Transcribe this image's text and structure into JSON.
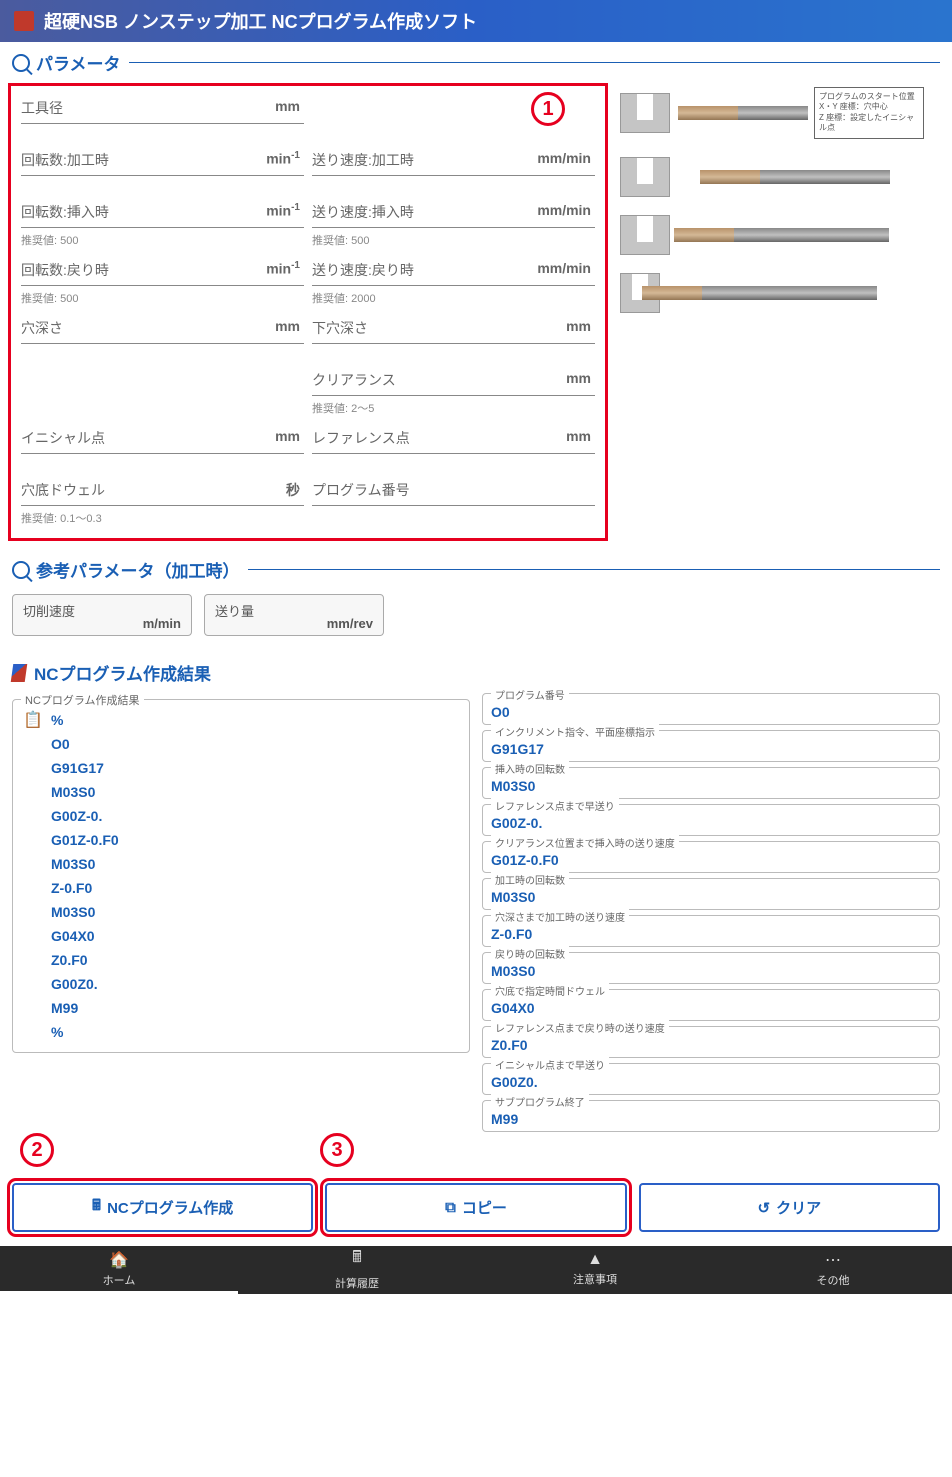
{
  "header": {
    "title": "超硬NSB ノンステップ加工 NCプログラム作成ソフト"
  },
  "sections": {
    "params": "パラメータ",
    "ref_params": "参考パラメータ（加工時）",
    "results": "NCプログラム作成結果"
  },
  "param_fields": {
    "tool_dia": {
      "label": "工具径",
      "unit": "mm"
    },
    "rpm_cut": {
      "label": "回転数:加工時",
      "unit": "min",
      "sup": "-1"
    },
    "feed_cut": {
      "label": "送り速度:加工時",
      "unit": "mm/min"
    },
    "rpm_insert": {
      "label": "回転数:挿入時",
      "unit": "min",
      "sup": "-1",
      "hint": "推奨値: 500"
    },
    "feed_insert": {
      "label": "送り速度:挿入時",
      "unit": "mm/min",
      "hint": "推奨値: 500"
    },
    "rpm_return": {
      "label": "回転数:戻り時",
      "unit": "min",
      "sup": "-1",
      "hint": "推奨値: 500"
    },
    "feed_return": {
      "label": "送り速度:戻り時",
      "unit": "mm/min",
      "hint": "推奨値: 2000"
    },
    "hole_depth": {
      "label": "穴深さ",
      "unit": "mm"
    },
    "prehole_depth": {
      "label": "下穴深さ",
      "unit": "mm"
    },
    "clearance": {
      "label": "クリアランス",
      "unit": "mm",
      "hint": "推奨値: 2～5"
    },
    "initial_pt": {
      "label": "イニシャル点",
      "unit": "mm"
    },
    "reference_pt": {
      "label": "レファレンス点",
      "unit": "mm"
    },
    "dwell": {
      "label": "穴底ドウェル",
      "unit": "秒",
      "hint": "推奨値: 0.1～0.3"
    },
    "prog_num": {
      "label": "プログラム番号"
    }
  },
  "ref_fields": {
    "cutting_speed": {
      "label": "切削速度",
      "unit": "m/min"
    },
    "feed_amount": {
      "label": "送り量",
      "unit": "mm/rev"
    }
  },
  "diagram": {
    "info_box": [
      "プログラムのスタート位置",
      "X・Y 座標：穴中心",
      "Z 座標：設定したイニシャル点"
    ]
  },
  "results": {
    "legend": "NCプログラム作成結果",
    "code": [
      "%",
      "O0",
      "G91G17",
      "M03S0",
      "G00Z-0.",
      "G01Z-0.F0",
      "M03S0",
      "Z-0.F0",
      "M03S0",
      "G04X0",
      "Z0.F0",
      "G00Z0.",
      "M99",
      "%"
    ],
    "explain": [
      {
        "label": "プログラム番号",
        "code": "O0"
      },
      {
        "label": "インクリメント指令、平面座標指示",
        "code": "G91G17"
      },
      {
        "label": "挿入時の回転数",
        "code": "M03S0"
      },
      {
        "label": "レファレンス点まで早送り",
        "code": "G00Z-0."
      },
      {
        "label": "クリアランス位置まで挿入時の送り速度",
        "code": "G01Z-0.F0"
      },
      {
        "label": "加工時の回転数",
        "code": "M03S0"
      },
      {
        "label": "穴深さまで加工時の送り速度",
        "code": "Z-0.F0"
      },
      {
        "label": "戻り時の回転数",
        "code": "M03S0"
      },
      {
        "label": "穴底で指定時間ドウェル",
        "code": "G04X0"
      },
      {
        "label": "レファレンス点まで戻り時の送り速度",
        "code": "Z0.F0"
      },
      {
        "label": "イニシャル点まで早送り",
        "code": "G00Z0."
      },
      {
        "label": "サブプログラム終了",
        "code": "M99"
      }
    ]
  },
  "buttons": {
    "create": "NCプログラム作成",
    "copy": "コピー",
    "clear": "クリア"
  },
  "nav": {
    "home": "ホーム",
    "history": "計算履歴",
    "caution": "注意事項",
    "other": "その他"
  },
  "callouts": {
    "c1": "1",
    "c2": "2",
    "c3": "3"
  }
}
